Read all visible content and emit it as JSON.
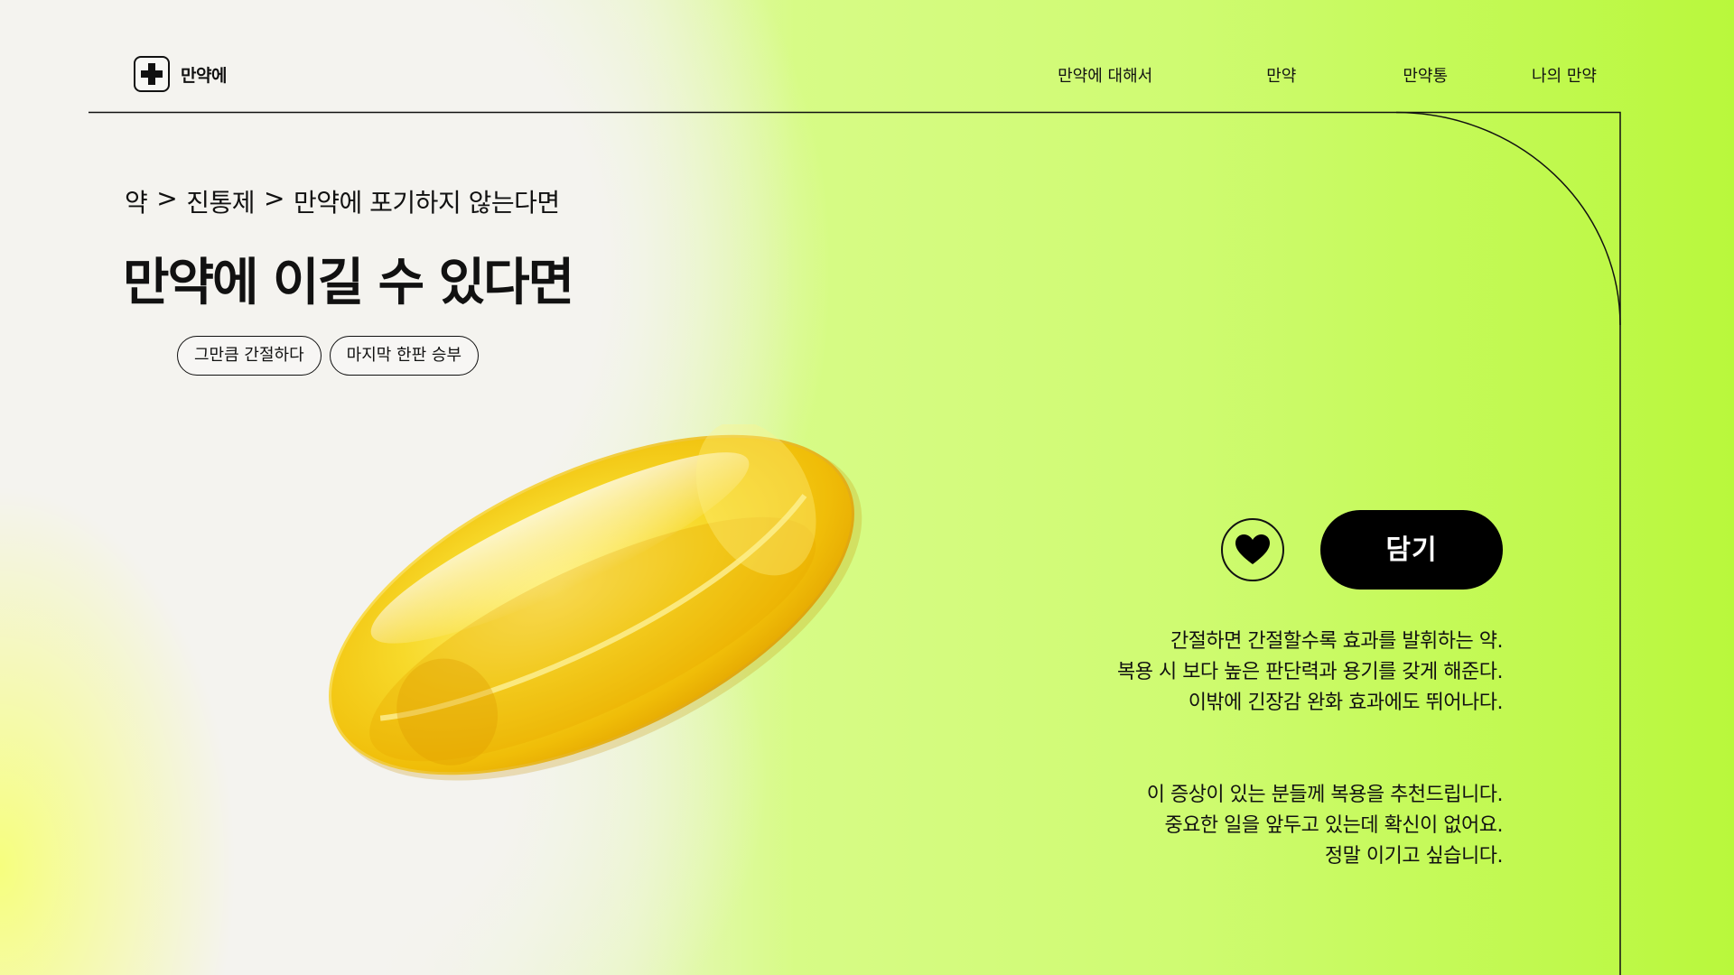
{
  "header": {
    "logo_icon": "medical-cross-icon",
    "logo_text": "만약에",
    "nav": [
      "만약에 대해서",
      "만약",
      "만약통",
      "나의 만약"
    ]
  },
  "hero": {
    "breadcrumb": [
      "약",
      "진통제",
      "만약에 포기하지 않는다면"
    ],
    "breadcrumb_separator": ">",
    "title": "만약에 이길 수 있다면",
    "tags": [
      "그만큼 간절하다",
      "마지막 한판 승부"
    ]
  },
  "product": {
    "image": "yellow-softgel-capsule",
    "favorite_icon": "heart-icon",
    "cart_button": "담기",
    "description": [
      "간절하면 간절할수록 효과를 발휘하는 약.",
      "복용 시 보다 높은 판단력과 용기를 갖게 해준다.",
      "이밖에 긴장감 완화 효과에도 뛰어나다."
    ],
    "recommendation": [
      "이 증상이 있는 분들께 복용을 추천드립니다.",
      "중요한 일을 앞두고 있는데 확신이 없어요.",
      "정말 이기고 싶습니다."
    ]
  },
  "colors": {
    "accent_green": "#c8fb5e",
    "background_light": "#f4f3ef",
    "capsule_yellow": "#f3c300",
    "button_black": "#000000"
  }
}
